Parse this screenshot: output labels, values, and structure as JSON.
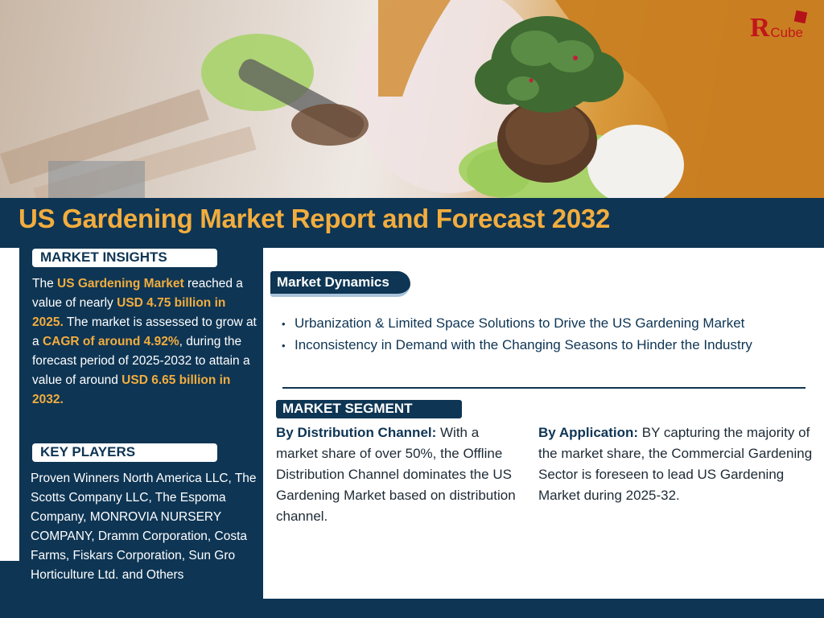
{
  "logo": {
    "mark": "Я",
    "text": "Cube"
  },
  "title": "US Gardening Market Report and Forecast 2032",
  "market_insights": {
    "heading": "MARKET INSIGHTS",
    "parts": [
      {
        "text": "The ",
        "highlight": false
      },
      {
        "text": "US Gardening Market",
        "highlight": true
      },
      {
        "text": " reached a value of nearly ",
        "highlight": false
      },
      {
        "text": "USD 4.75 billion in 2025.",
        "highlight": true
      },
      {
        "text": " The market is assessed to grow at a ",
        "highlight": false
      },
      {
        "text": "CAGR of around 4.92%",
        "highlight": true
      },
      {
        "text": ", during the forecast period of 2025-2032 to attain a value of around ",
        "highlight": false
      },
      {
        "text": "USD 6.65 billion in 2032.",
        "highlight": true
      }
    ]
  },
  "key_players": {
    "heading": "KEY PLAYERS",
    "text": "Proven Winners North America LLC, The Scotts Company LLC, The Espoma Company, MONROVIA NURSERY COMPANY, Dramm Corporation, Costa Farms, Fiskars Corporation, Sun Gro Horticulture Ltd. and Others"
  },
  "market_dynamics": {
    "heading": "Market Dynamics",
    "bullets": [
      "Urbanization & Limited Space Solutions to Drive the US Gardening Market",
      "Inconsistency in Demand with the Changing Seasons to Hinder the Industry"
    ]
  },
  "market_segment": {
    "heading": "MARKET SEGMENT",
    "distribution": {
      "label": "By Distribution Channel:",
      "text": " With a market share of over 50%, the Offline Distribution Channel dominates the US Gardening Market based on distribution channel."
    },
    "application": {
      "label": "By Application:",
      "text": " BY capturing the majority of the market share, the Commercial Gardening Sector is foreseen to lead US Gardening Market during 2025-32."
    }
  },
  "colors": {
    "navy": "#0e3554",
    "accent": "#f2ad3e",
    "logo_red": "#c3151c",
    "sweater": "#c97f22",
    "glove": "#a8d36a"
  }
}
